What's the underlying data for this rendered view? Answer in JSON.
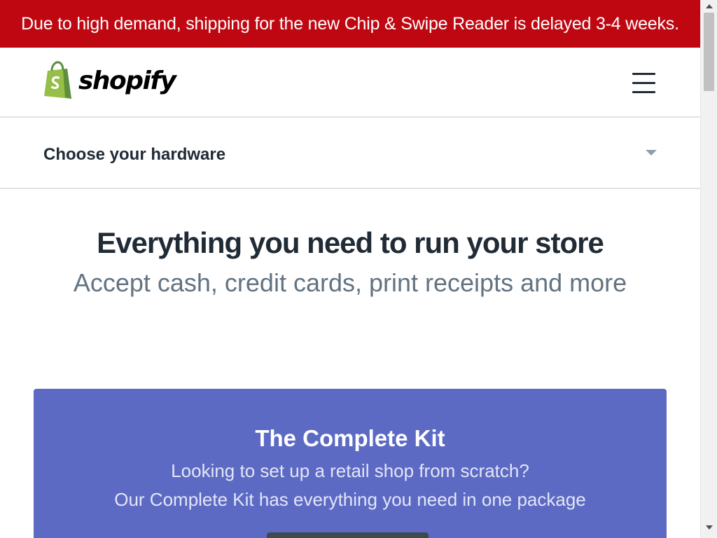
{
  "banner": {
    "text": "Due to high demand, shipping for the new Chip & Swipe Reader is delayed 3-4 weeks."
  },
  "header": {
    "logo_text": "shopify",
    "logo_icon": "shopify-bag-icon",
    "menu_icon": "hamburger-menu-icon"
  },
  "hardware_selector": {
    "label": "Choose your hardware",
    "icon": "caret-down-icon"
  },
  "hero": {
    "title": "Everything you need to run your store",
    "subtitle": "Accept cash, credit cards, print receipts and more"
  },
  "kit_card": {
    "title": "The Complete Kit",
    "line1": "Looking to set up a retail shop from scratch?",
    "line2": "Our Complete Kit has everything you need in one package"
  },
  "colors": {
    "banner_bg": "#bf0711",
    "card_bg": "#5c6ac4",
    "brand_green": "#95bf47",
    "text_dark": "#212b36",
    "text_muted": "#637381"
  }
}
